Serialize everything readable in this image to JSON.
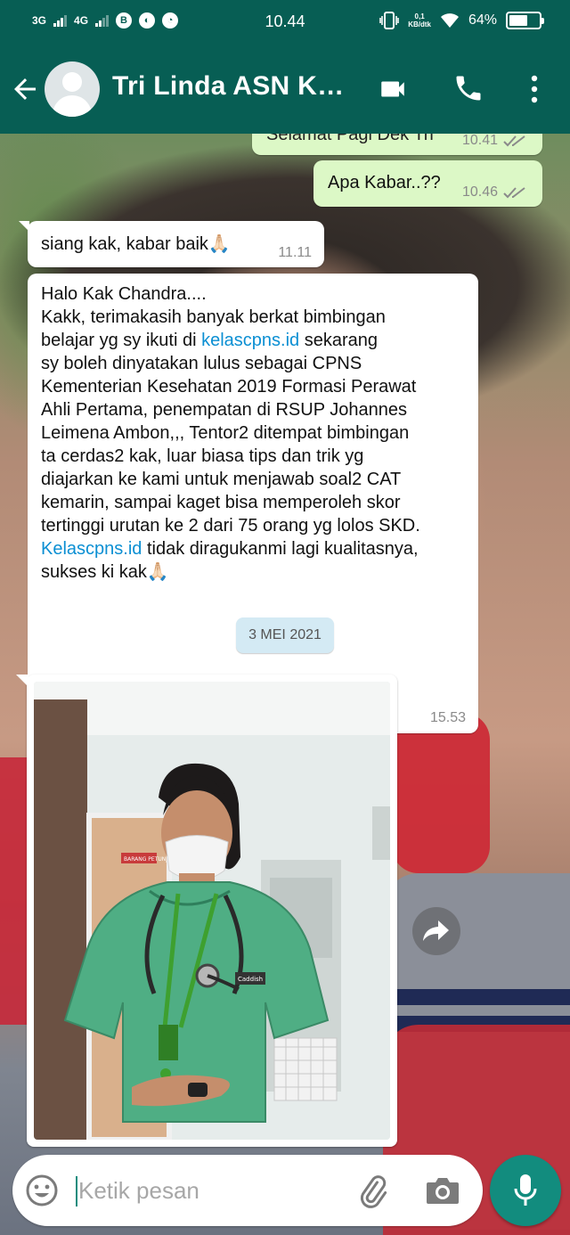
{
  "status_bar": {
    "net1": "3G",
    "net2": "4G",
    "time": "10.44",
    "speed_value": "0,1",
    "speed_unit": "KB/dtk",
    "battery": "64%",
    "battery_level": 0.64
  },
  "header": {
    "contact_name": "Tri Linda ASN Ke..."
  },
  "messages": [
    {
      "direction": "out",
      "text": "Selamat Pagi Dek Tri",
      "time": "10.41",
      "status": "read"
    },
    {
      "direction": "out",
      "text": "Apa Kabar..??",
      "time": "10.46",
      "status": "read"
    },
    {
      "direction": "in",
      "text": "siang kak, kabar baik🙏🏻",
      "time": "11.11"
    },
    {
      "direction": "in",
      "time": "15.53",
      "lines": [
        "Halo Kak Chandra....",
        "Kakk, terimakasih banyak berkat bimbingan",
        "belajar yg sy ikuti di ",
        "kelascpns.id",
        " sekarang",
        "sy boleh dinyatakan lulus sebagai CPNS",
        "Kementerian Kesehatan 2019 Formasi Perawat",
        "Ahli Pertama, penempatan di RSUP Johannes",
        "Leimena Ambon,,, Tentor2 ditempat bimbingan",
        "ta cerdas2 kak, luar biasa tips dan trik yg",
        "diajarkan ke kami untuk menjawab soal2 CAT",
        "kemarin, sampai kaget bisa memperoleh skor",
        "tertinggi urutan ke 2 dari 75 orang yg lolos SKD.",
        "Kelascpns.id",
        " tidak diragukanmi lagi kualitasnya,",
        "sukses ki kak🙏🏻"
      ]
    }
  ],
  "date_divider": "3 MEI 2021",
  "photo_badge": "Caddish",
  "photo_sign": "BARANG PETUNJUK",
  "composer": {
    "placeholder": "Ketik pesan"
  },
  "icons": {
    "back": "arrow-left-icon",
    "video": "video-camera-icon",
    "call": "phone-icon",
    "menu": "more-vertical-icon",
    "emoji": "smiley-icon",
    "attach": "paperclip-icon",
    "camera": "camera-icon",
    "mic": "microphone-icon",
    "forward": "forward-arrow-icon"
  },
  "colors": {
    "header": "#075e54",
    "outgoing_bubble": "#dcf8c6",
    "incoming_bubble": "#ffffff",
    "link": "#0b8fd3",
    "accent": "#128c7e",
    "read_ticks": "#8a8a8a"
  }
}
